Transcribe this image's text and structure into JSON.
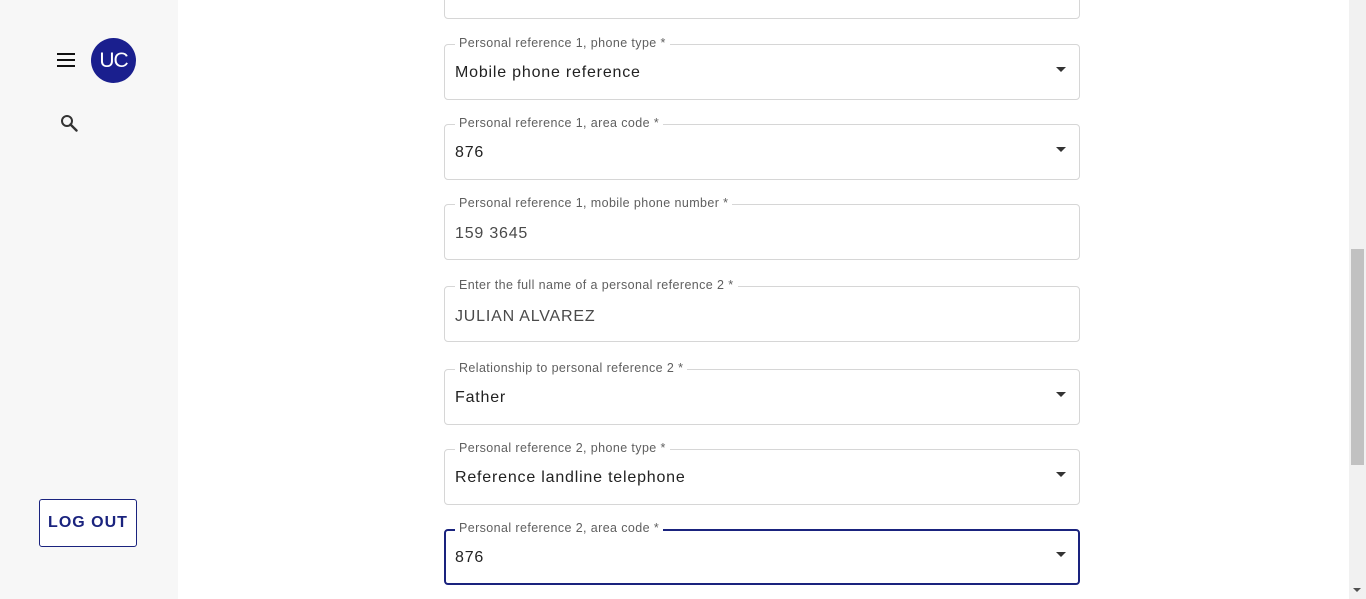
{
  "sidebar": {
    "avatar_initials": "UC",
    "menu_icon": "hamburger-menu-icon",
    "search_icon": "search-icon",
    "logout_label": "LOG OUT"
  },
  "form": {
    "fields": [
      {
        "label": "",
        "value": "",
        "kind": "text"
      },
      {
        "label": "Personal reference 1, phone type *",
        "value": "Mobile phone reference",
        "kind": "select"
      },
      {
        "label": "Personal reference 1, area code *",
        "value": "876",
        "kind": "select"
      },
      {
        "label": "Personal reference 1, mobile phone number *",
        "value": "159 3645",
        "kind": "text"
      },
      {
        "label": "Enter the full name of a personal reference 2 *",
        "value": "JULIAN ALVAREZ",
        "kind": "text"
      },
      {
        "label": "Relationship to personal reference 2 *",
        "value": "Father",
        "kind": "select"
      },
      {
        "label": "Personal reference 2, phone type *",
        "value": "Reference landline telephone",
        "kind": "select"
      },
      {
        "label": "Personal reference 2, area code *",
        "value": "876",
        "kind": "select",
        "focused": true
      }
    ]
  },
  "colors": {
    "accent": "#1a237e",
    "avatar_bg": "#1a1f8e",
    "sidebar_bg": "#f7f7f7"
  }
}
